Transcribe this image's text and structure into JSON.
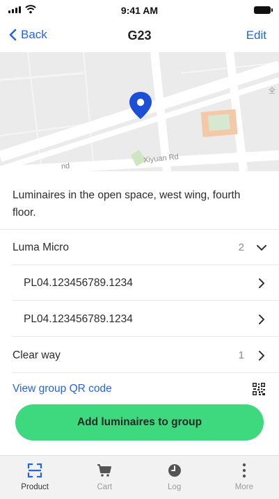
{
  "status_bar": {
    "time": "9:41 AM"
  },
  "nav": {
    "back_label": "Back",
    "title": "G23",
    "edit_label": "Edit"
  },
  "map": {
    "street_label_main": "Xiyuan Rd",
    "street_label_partial": "nd",
    "corner_glyph": "全",
    "pin_color": "#1d4ed8"
  },
  "description": "Luminaires in the open space, west wing, fourth floor.",
  "list": {
    "group": {
      "label": "Luma Micro",
      "count": "2"
    },
    "items": [
      {
        "label": "PL04.123456789.1234"
      },
      {
        "label": "PL04.123456789.1234"
      }
    ],
    "clear_way": {
      "label": "Clear way",
      "count": "1"
    },
    "qr_link": "View group QR code"
  },
  "primary_action": "Add luminaires to group",
  "tab_bar": {
    "tabs": [
      {
        "label": "Product",
        "icon": "scan-icon",
        "active": true
      },
      {
        "label": "Cart",
        "icon": "cart-icon",
        "active": false
      },
      {
        "label": "Log",
        "icon": "clock-icon",
        "active": false
      },
      {
        "label": "More",
        "icon": "more-icon",
        "active": false
      }
    ]
  },
  "colors": {
    "accent": "#2563eb",
    "primary_button": "#3ed87f",
    "tab_bar_bg": "#f2f2f2"
  }
}
